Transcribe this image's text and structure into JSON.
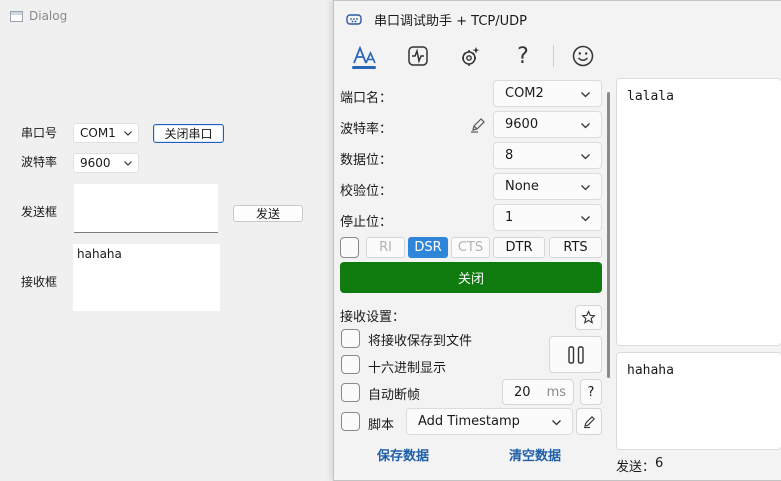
{
  "dialog": {
    "title": "Dialog",
    "port_label": "串口号",
    "port_value": "COM1",
    "close_port_button": "关闭串口",
    "baud_label": "波特率",
    "baud_value": "9600",
    "send_label": "发送框",
    "send_button": "发送",
    "send_text": "",
    "recv_label": "接收框",
    "recv_text": "hahaha"
  },
  "app": {
    "title": "串口调试助手 + TCP/UDP",
    "toolbar": [
      "font-a-icon",
      "waveform-icon",
      "settings-gear-icon",
      "help-icon",
      "smiley-icon"
    ],
    "help_glyph": "?",
    "settings": {
      "port_name_label": "端口名：",
      "port_name_value": "COM2",
      "baud_label": "波特率：",
      "baud_value": "9600",
      "data_bits_label": "数据位：",
      "data_bits_value": "8",
      "parity_label": "校验位：",
      "parity_value": "None",
      "stop_bits_label": "停止位：",
      "stop_bits_value": "1"
    },
    "signals": {
      "ri": "RI",
      "dsr": "DSR",
      "cts": "CTS",
      "dtr": "DTR",
      "rts": "RTS"
    },
    "close_button": "关闭",
    "recv_settings": {
      "heading": "接收设置：",
      "save_to_file": "将接收保存到文件",
      "hex_display": "十六进制显示",
      "auto_frame": "自动断帧",
      "frame_ms_value": "20",
      "frame_ms_unit": "ms",
      "frame_help": "?",
      "script_label": "脚本",
      "script_value": "Add Timestamp"
    },
    "save_data": "保存数据",
    "clear_data": "清空数据",
    "receive_text": "lalala",
    "send_text": "hahaha",
    "send_count_label": "发送：",
    "send_count_value": "6"
  },
  "colors": {
    "accent_blue": "#2f86d8",
    "close_green": "#0f7b0f",
    "link_blue": "#1f5fa8"
  }
}
